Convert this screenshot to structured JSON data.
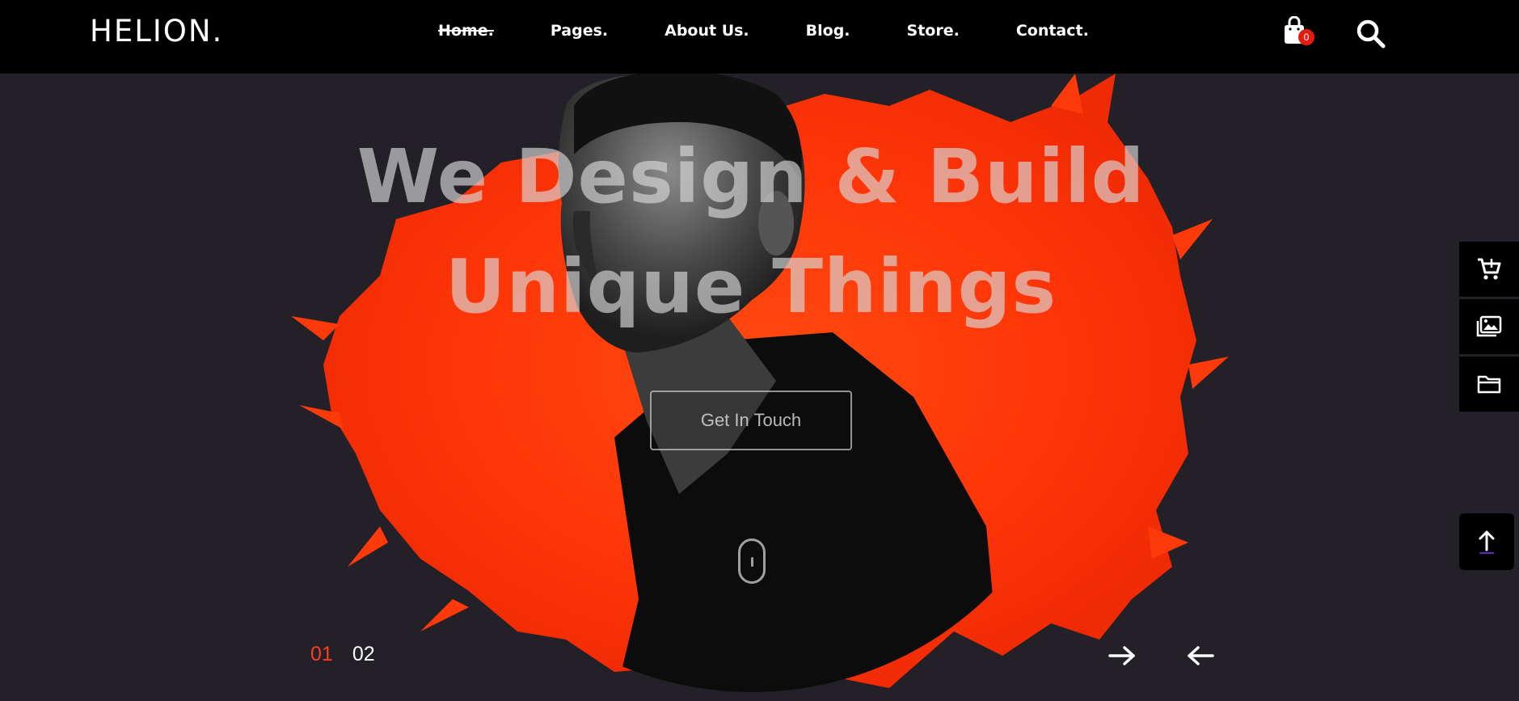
{
  "brand": {
    "logo": "HELION."
  },
  "nav": {
    "items": [
      {
        "label": "Home.",
        "active": true
      },
      {
        "label": "Pages.",
        "active": false
      },
      {
        "label": "About Us.",
        "active": false
      },
      {
        "label": "Blog.",
        "active": false
      },
      {
        "label": "Store.",
        "active": false
      },
      {
        "label": "Contact.",
        "active": false
      }
    ],
    "cart_icon": "shopping-bag-icon",
    "cart_count": "0",
    "search_icon": "search-icon"
  },
  "hero": {
    "title_line1": "We Design & Build",
    "title_line2": "Unique Things",
    "cta_label": "Get In Touch",
    "scroll_icon": "mouse-scroll-icon",
    "slides": {
      "current": "01",
      "next": "02"
    },
    "next_icon": "arrow-right-icon",
    "prev_icon": "arrow-left-icon"
  },
  "side_dock": {
    "items": [
      {
        "icon": "cart-icon"
      },
      {
        "icon": "images-icon"
      },
      {
        "icon": "folder-icon"
      }
    ],
    "back_to_top_icon": "arrow-up-icon"
  },
  "colors": {
    "background": "#232127",
    "navbar": "#000000",
    "accent": "#ff3b1a",
    "badge": "#e51b12",
    "splash": "#ff3a0a"
  }
}
